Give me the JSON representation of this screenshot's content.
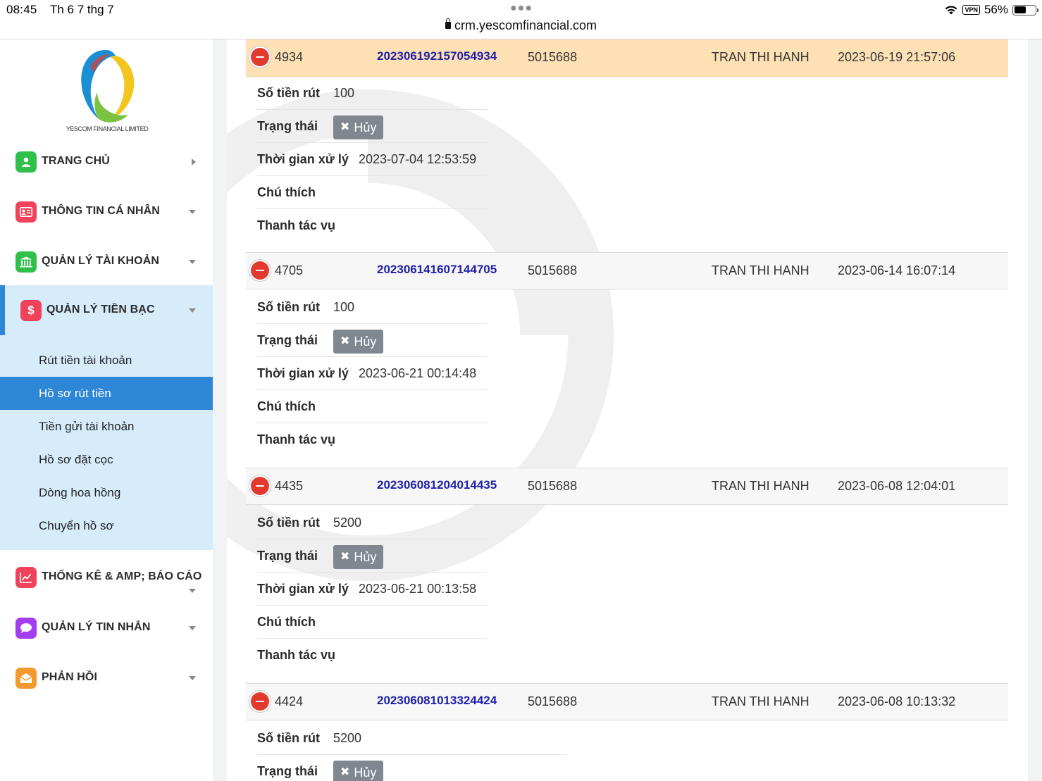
{
  "status_bar": {
    "time": "08:45",
    "date": "Th 6 7 thg 7",
    "url": "crm.yescomfinancial.com",
    "vpn": "VPN",
    "battery": "56%",
    "battery_level": 0.56
  },
  "logo": {
    "text": "YESCOM FINANCIAL LIMITED"
  },
  "sidebar": {
    "items": [
      {
        "label": "TRANG CHỦ",
        "icon": "user-icon",
        "color": "#2fbf4a"
      },
      {
        "label": "THÔNG TIN CÁ NHÂN",
        "icon": "id-card-icon",
        "color": "#f0435b"
      },
      {
        "label": "QUẢN LÝ TÀI KHOẢN",
        "icon": "bank-icon",
        "color": "#2fbf4a"
      },
      {
        "label": "QUẢN LÝ TIỀN BẠC",
        "icon": "dollar-icon",
        "color": "#f0435b"
      },
      {
        "label": "THỐNG KÊ & AMP; BÁO CÁO",
        "icon": "chart-icon",
        "color": "#f0435b"
      },
      {
        "label": "QUẢN LÝ TIN NHẮN",
        "icon": "message-icon",
        "color": "#a23df0"
      },
      {
        "label": "PHẢN HỒI",
        "icon": "envelope-icon",
        "color": "#f29a2e"
      }
    ],
    "submenu": [
      "Rút tiền tài khoản",
      "Hồ sơ rút tiền",
      "Tiền gửi tài khoản",
      "Hồ sơ đặt cọc",
      "Dòng hoa hồng",
      "Chuyển hồ sơ"
    ]
  },
  "labels": {
    "amount": "Số tiền rút",
    "status": "Trạng thái",
    "processed_time": "Thời gian xử lý",
    "note": "Chú thích",
    "actions": "Thanh tác vụ"
  },
  "status_badge": {
    "icon": "✖",
    "text": "Hủy"
  },
  "records": [
    {
      "id": "4934",
      "code": "202306192157054934",
      "account": "5015688",
      "name": "TRAN THI HANH",
      "date": "2023-06-19 21:57:06",
      "amount": "100",
      "processed": "2023-07-04 12:53:59"
    },
    {
      "id": "4705",
      "code": "202306141607144705",
      "account": "5015688",
      "name": "TRAN THI HANH",
      "date": "2023-06-14 16:07:14",
      "amount": "100",
      "processed": "2023-06-21 00:14:48"
    },
    {
      "id": "4435",
      "code": "202306081204014435",
      "account": "5015688",
      "name": "TRAN THI HANH",
      "date": "2023-06-08 12:04:01",
      "amount": "5200",
      "processed": "2023-06-21 00:13:58"
    },
    {
      "id": "4424",
      "code": "202306081013324424",
      "account": "5015688",
      "name": "TRAN THI HANH",
      "date": "2023-06-08 10:13:32",
      "amount": "5200"
    }
  ]
}
